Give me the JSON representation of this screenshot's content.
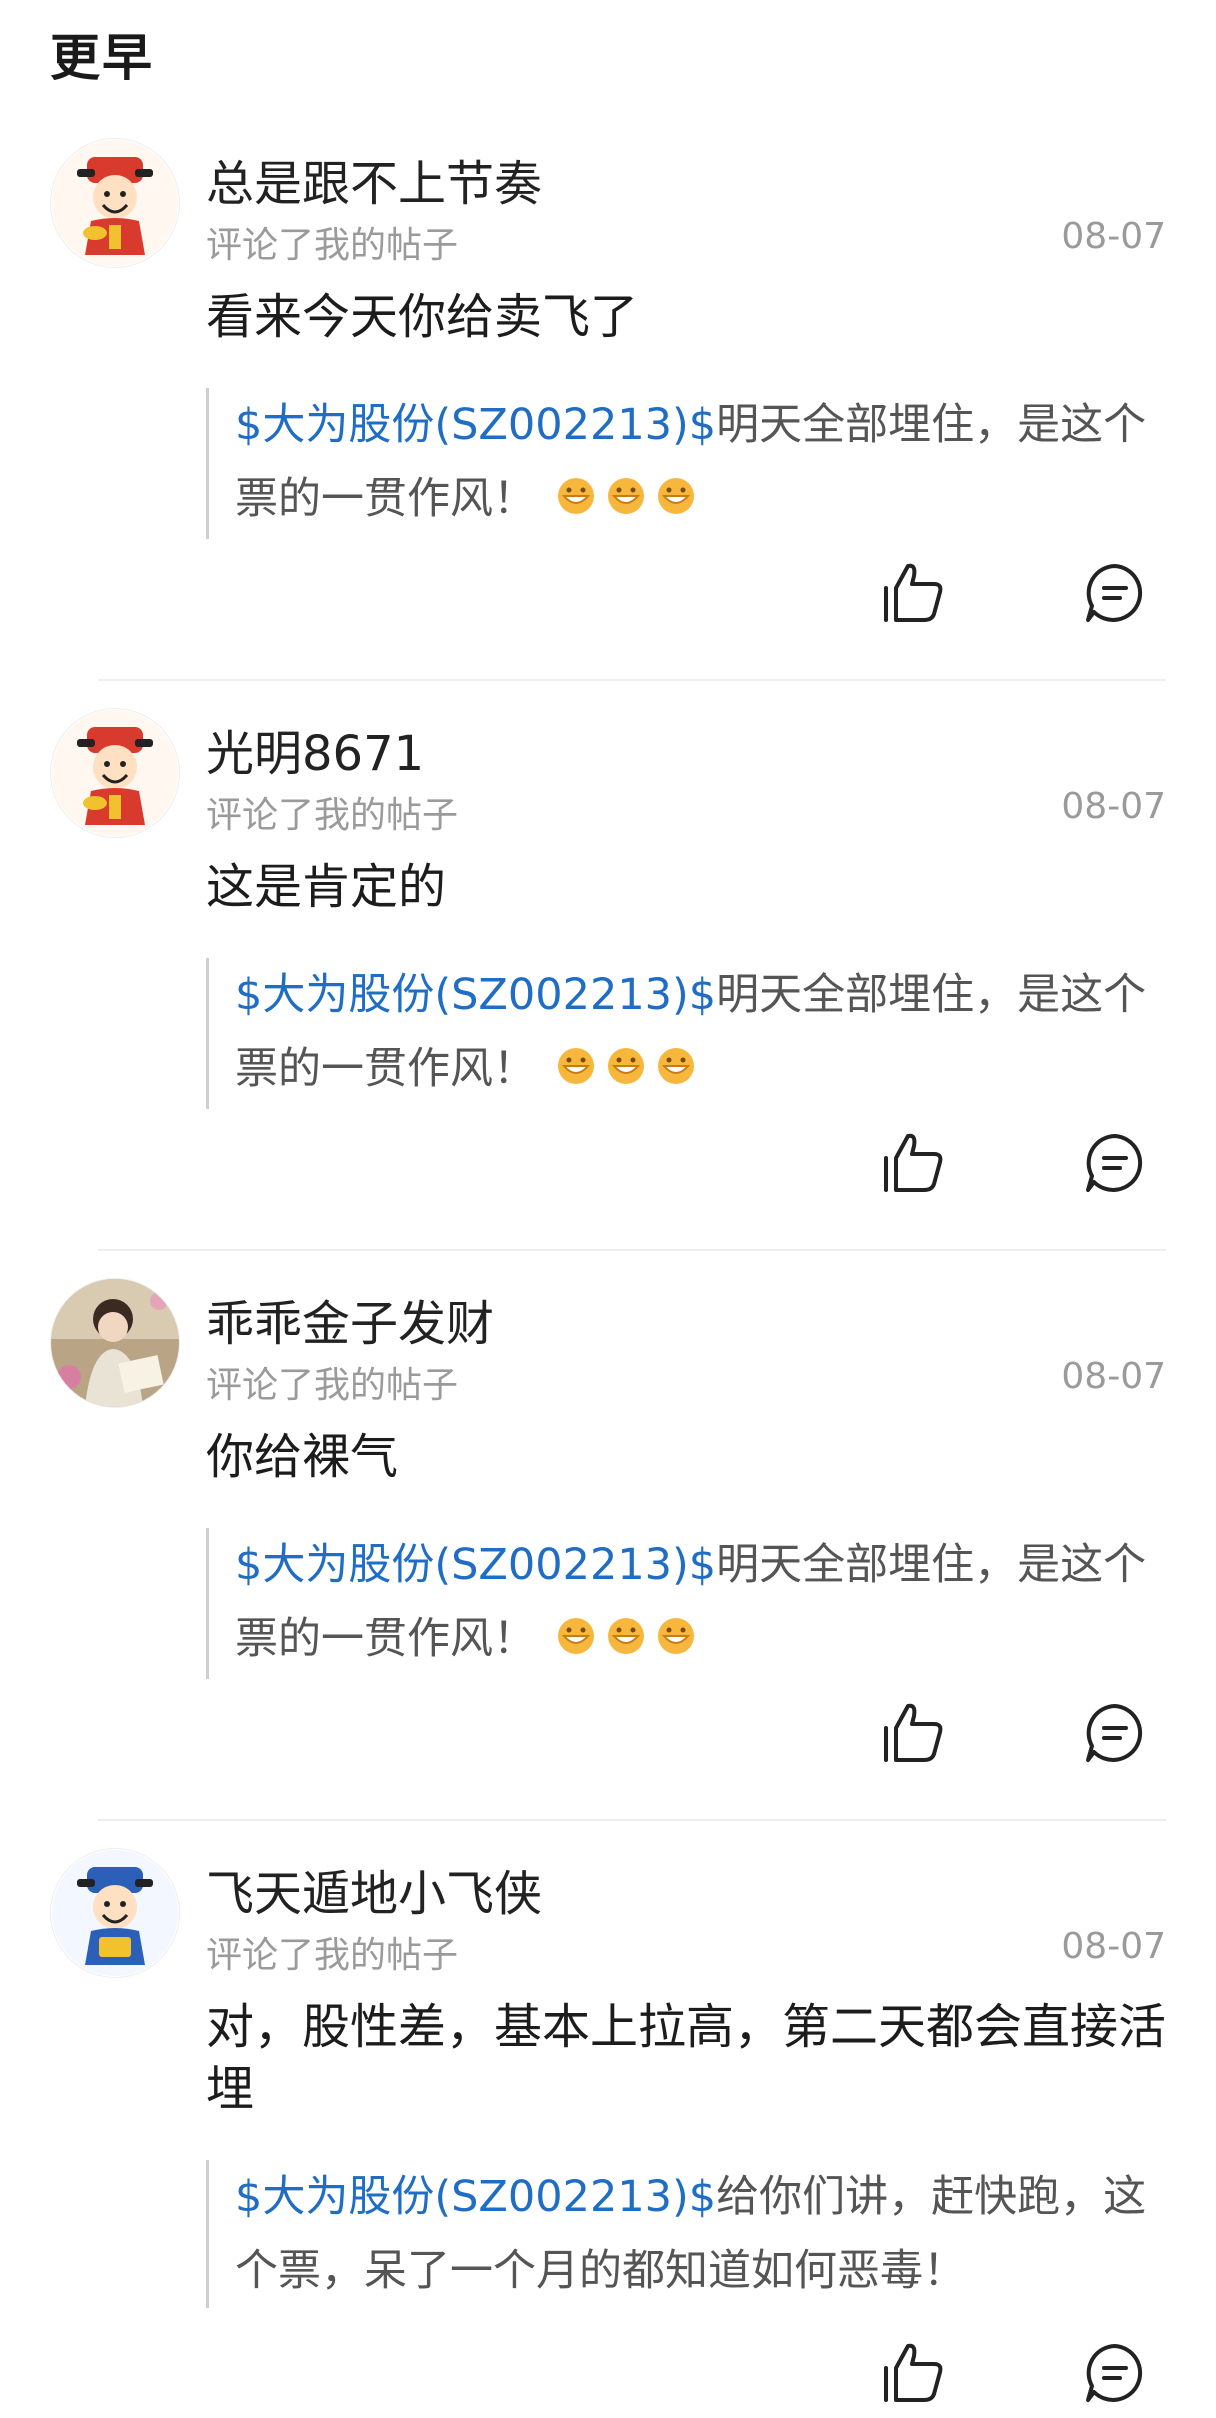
{
  "section": {
    "title": "更早"
  },
  "colors": {
    "stock_link": "#1f6dc4",
    "muted": "#9a9a9a"
  },
  "items": [
    {
      "username": "总是跟不上节奏",
      "subtitle": "评论了我的帖子",
      "date": "08-07",
      "comment": "看来今天你给卖飞了",
      "quote_stock": "$大为股份(SZ002213)$",
      "quote_text": "明天全部埋住，是这个票的一贯作风！",
      "avatar": "god-of-wealth-avatar"
    },
    {
      "username": "光明8671",
      "subtitle": "评论了我的帖子",
      "date": "08-07",
      "comment": "这是肯定的",
      "quote_stock": "$大为股份(SZ002213)$",
      "quote_text": "明天全部埋住，是这个票的一贯作风！",
      "avatar": "god-of-wealth-avatar"
    },
    {
      "username": "乖乖金子发财",
      "subtitle": "评论了我的帖子",
      "date": "08-07",
      "comment": "你给裸气",
      "quote_stock": "$大为股份(SZ002213)$",
      "quote_text": "明天全部埋住，是这个票的一贯作风！",
      "avatar": "girl-reading-avatar"
    },
    {
      "username": "飞天遁地小飞侠",
      "subtitle": "评论了我的帖子",
      "date": "08-07",
      "comment": "对，股性差，基本上拉高，第二天都会直接活埋",
      "quote_stock": "$大为股份(SZ002213)$",
      "quote_text": "给你们讲，赶快跑，这个票，呆了一个月的都知道如何恶毒！",
      "avatar": "blue-god-of-wealth-avatar"
    }
  ],
  "icons": {
    "like": "thumbs-up-icon",
    "reply": "comment-bubble-icon",
    "emoji": "grinning-face-emoji"
  }
}
